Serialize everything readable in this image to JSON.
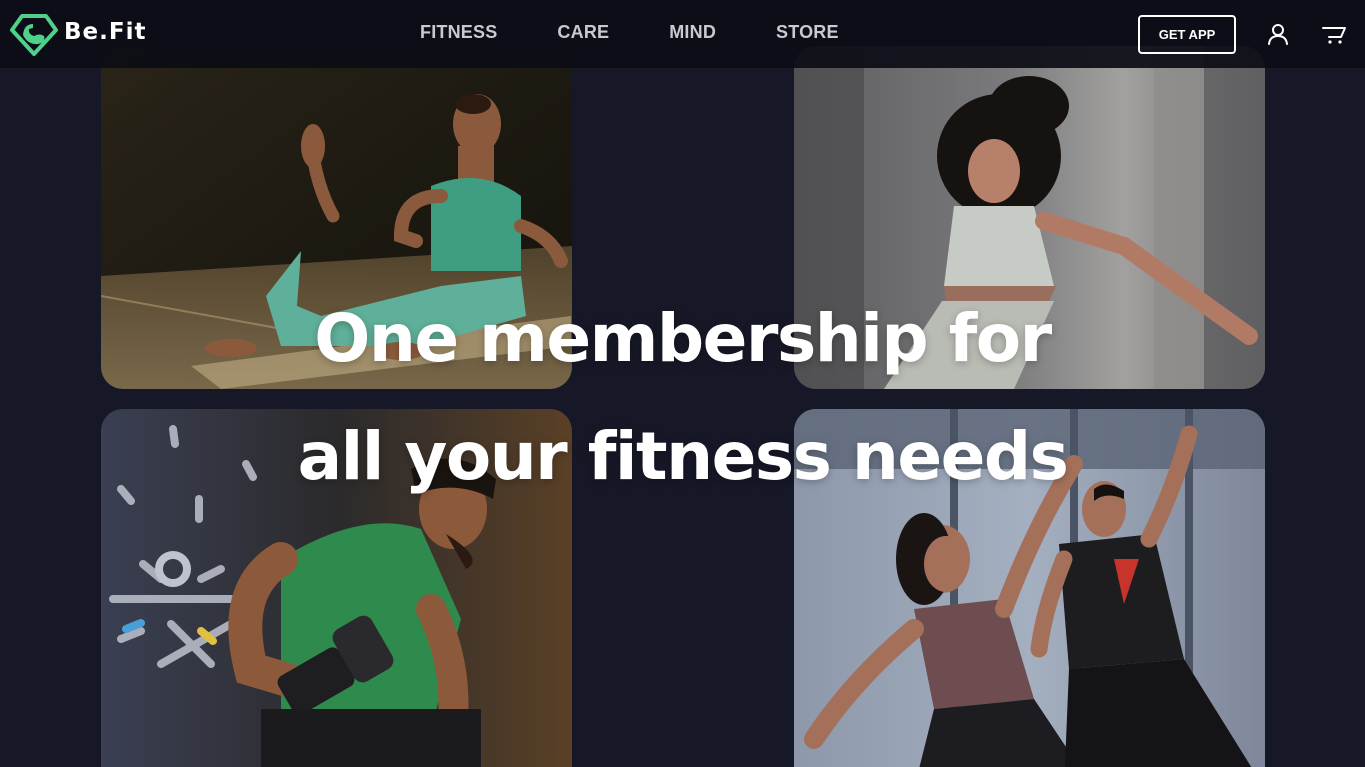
{
  "brand": {
    "name": "Be.Fit",
    "accent": "#4fd18b"
  },
  "nav": {
    "items": [
      {
        "label": "FITNESS"
      },
      {
        "label": "CARE"
      },
      {
        "label": "MIND"
      },
      {
        "label": "STORE"
      }
    ]
  },
  "header": {
    "get_app_label": "GET APP",
    "user_icon": "user-icon",
    "cart_icon": "cart-icon"
  },
  "hero": {
    "line1": "One membership for",
    "line2": "all your fitness needs"
  },
  "colors": {
    "background": "#171827",
    "header_bg": "#0c0d16",
    "text": "#ffffff"
  }
}
